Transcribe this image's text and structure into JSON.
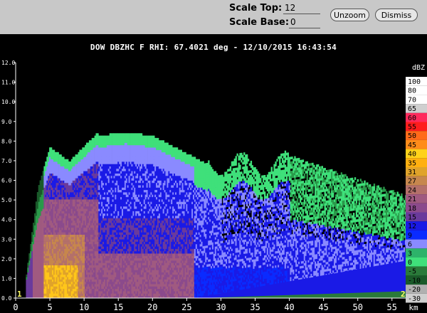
{
  "toolbar": {
    "scale_top_label": "Scale Top:",
    "scale_top_value": "12",
    "scale_base_label": "Scale Base:",
    "scale_base_value": "0",
    "unzoom_label": "Unzoom",
    "dismiss_label": "Dismiss"
  },
  "plot": {
    "title": "DOW DBZHC F  RHI: 67.4021 deg  -  12/10/2015 16:43:54",
    "x_unit": "km",
    "corner_left": "1",
    "corner_right": "2"
  },
  "colors": {
    "toolbar_bg": "#c8c8c8",
    "plot_bg": "#000000",
    "axis": "#ffffff"
  },
  "chart_data": {
    "type": "heatmap",
    "title": "DOW DBZHC F  RHI: 67.4021 deg  -  12/10/2015 16:43:54",
    "x": {
      "label": "km",
      "range": [
        0,
        57
      ],
      "ticks": [
        0,
        5,
        10,
        15,
        20,
        25,
        30,
        35,
        40,
        45,
        50,
        55
      ]
    },
    "y": {
      "range": [
        0,
        12
      ],
      "ticks": [
        "0.0",
        "1.0",
        "2.0",
        "3.0",
        "4.0",
        "5.0",
        "6.0",
        "7.0",
        "8.0",
        "9.0",
        "10.0",
        "11.0",
        "12.0"
      ]
    },
    "colorbar": {
      "unit": "dBZ",
      "levels": [
        {
          "label": "100",
          "color": "#ffffff"
        },
        {
          "label": "80",
          "color": "#ffffff"
        },
        {
          "label": "70",
          "color": "#ffffff"
        },
        {
          "label": "65",
          "color": "#cfcfcf"
        },
        {
          "label": "60",
          "color": "#ff2a5c"
        },
        {
          "label": "55",
          "color": "#ff1d1d"
        },
        {
          "label": "50",
          "color": "#ff6a1a"
        },
        {
          "label": "45",
          "color": "#ff8c1a"
        },
        {
          "label": "40",
          "color": "#ffd21a"
        },
        {
          "label": "35",
          "color": "#ffb010"
        },
        {
          "label": "31",
          "color": "#e0a32a"
        },
        {
          "label": "27",
          "color": "#c7874d"
        },
        {
          "label": "24",
          "color": "#b4706a"
        },
        {
          "label": "21",
          "color": "#a05a80"
        },
        {
          "label": "18",
          "color": "#8b4a8c"
        },
        {
          "label": "15",
          "color": "#6a3a9c"
        },
        {
          "label": "12",
          "color": "#1a1ae6"
        },
        {
          "label": "9",
          "color": "#0a2bff"
        },
        {
          "label": "6",
          "color": "#8a8aff"
        },
        {
          "label": "3",
          "color": "#2db36a"
        },
        {
          "label": "0",
          "color": "#3fe07a"
        },
        {
          "label": "-5",
          "color": "#2a7a3a"
        },
        {
          "label": "-10",
          "color": "#1a5a2a"
        },
        {
          "label": "-20",
          "color": "#b0b0b0"
        },
        {
          "label": "-30",
          "color": "#cfcfcf"
        }
      ]
    }
  }
}
